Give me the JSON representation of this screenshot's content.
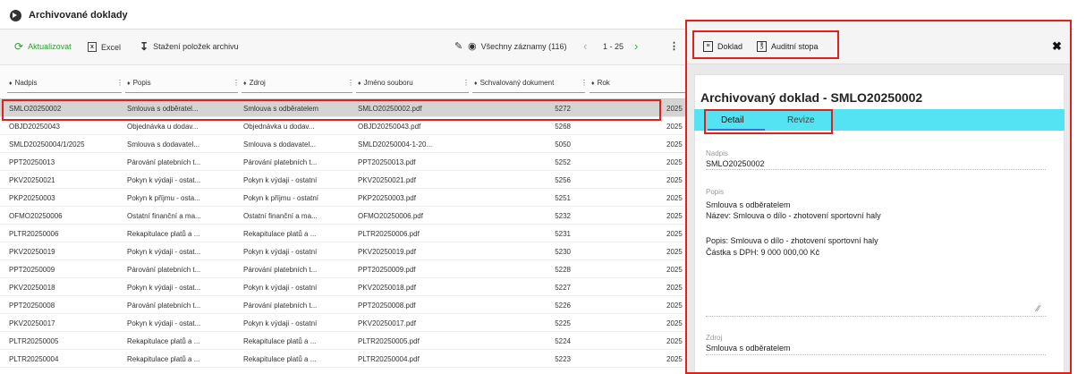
{
  "app": {
    "title": "Archivované doklady"
  },
  "toolbar": {
    "refresh_label": "Aktualizovat",
    "excel_label": "Excel",
    "download_label": "Stažení položek archivu",
    "filter_label": "Všechny záznamy (116)",
    "pager_label": "1 - 25"
  },
  "columns": [
    "Nadpis",
    "Popis",
    "Zdroj",
    "Jméno souboru",
    "Schvalovaný dokument",
    "Rok"
  ],
  "rows": [
    [
      "SMLO20250002",
      "Smlouva s odběratel...",
      "Smlouva s odběratelem",
      "SMLO20250002.pdf",
      "5272",
      "2025"
    ],
    [
      "OBJD20250043",
      "Objednávka u dodav...",
      "Objednávka u dodav...",
      "OBJD20250043.pdf",
      "5268",
      "2025"
    ],
    [
      "SMLD20250004/1/2025",
      "Smlouva s dodavatel...",
      "Smlouva s dodavatel...",
      "SMLD20250004-1-20...",
      "5050",
      "2025"
    ],
    [
      "PPT20250013",
      "Párování platebních t...",
      "Párování platebních t...",
      "PPT20250013.pdf",
      "5252",
      "2025"
    ],
    [
      "PKV20250021",
      "Pokyn k výdaji - ostat...",
      "Pokyn k výdaji - ostatní",
      "PKV20250021.pdf",
      "5256",
      "2025"
    ],
    [
      "PKP20250003",
      "Pokyn k příjmu - osta...",
      "Pokyn k příjmu - ostatní",
      "PKP20250003.pdf",
      "5251",
      "2025"
    ],
    [
      "OFMO20250006",
      "Ostatní finanční a ma...",
      "Ostatní finanční a ma...",
      "OFMO20250006.pdf",
      "5232",
      "2025"
    ],
    [
      "PLTR20250006",
      "Rekapitulace platů a ...",
      "Rekapitulace platů a ...",
      "PLTR20250006.pdf",
      "5231",
      "2025"
    ],
    [
      "PKV20250019",
      "Pokyn k výdaji - ostat...",
      "Pokyn k výdaji - ostatní",
      "PKV20250019.pdf",
      "5230",
      "2025"
    ],
    [
      "PPT20250009",
      "Párování platebních t...",
      "Párování platebních t...",
      "PPT20250009.pdf",
      "5228",
      "2025"
    ],
    [
      "PKV20250018",
      "Pokyn k výdaji - ostat...",
      "Pokyn k výdaji - ostatní",
      "PKV20250018.pdf",
      "5227",
      "2025"
    ],
    [
      "PPT20250008",
      "Párování platebních t...",
      "Párování platebních t...",
      "PPT20250008.pdf",
      "5226",
      "2025"
    ],
    [
      "PKV20250017",
      "Pokyn k výdaji - ostat...",
      "Pokyn k výdaji - ostatní",
      "PKV20250017.pdf",
      "5225",
      "2025"
    ],
    [
      "PLTR20250005",
      "Rekapitulace platů a ...",
      "Rekapitulace platů a ...",
      "PLTR20250005.pdf",
      "5224",
      "2025"
    ],
    [
      "PLTR20250004",
      "Rekapitulace platů a ...",
      "Rekapitulace platů a ...",
      "PLTR20250004.pdf",
      "5223",
      "2025"
    ]
  ],
  "selected_row": 0,
  "detail": {
    "doc_button": "Doklad",
    "audit_button": "Auditní stopa",
    "title": "Archivovaný doklad - SMLO20250002",
    "tabs": [
      "Detail",
      "Revize"
    ],
    "nadpis_label": "Nadpis",
    "nadpis_value": "SMLO20250002",
    "popis_label": "Popis",
    "popis_line1": "Smlouva s odběratelem",
    "popis_line2": "Název: Smlouva o dílo - zhotovení sportovní haly",
    "popis_line3": "Popis: Smlouva o dílo - zhotovení sportovní haly",
    "popis_line4": "Částka s DPH:  9 000 000,00 Kč",
    "zdroj_label": "Zdroj",
    "zdroj_value": "Smlouva s odběratelem"
  },
  "colors": {
    "accent_green": "#2e9e2e",
    "tab_bar": "#53e3f2",
    "highlight": "#e0201a"
  },
  "icons": [
    "logo-icon",
    "refresh-icon",
    "excel-icon",
    "download-icon",
    "eraser-icon",
    "eye-icon",
    "prev-icon",
    "next-icon",
    "more-icon",
    "document-icon",
    "pdf-icon",
    "close-icon",
    "sort-icon",
    "column-menu-icon",
    "resize-handle-icon"
  ]
}
